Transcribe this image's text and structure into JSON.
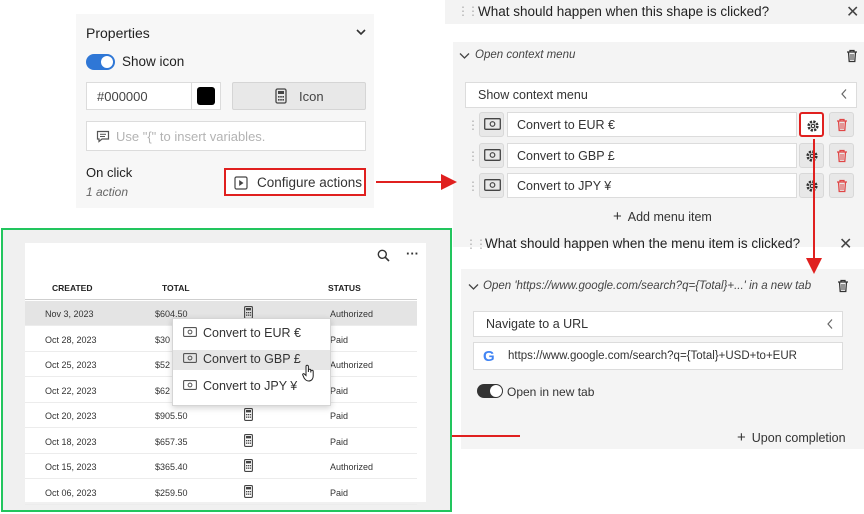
{
  "properties": {
    "title": "Properties",
    "show_icon_label": "Show icon",
    "color_value": "#000000",
    "icon_button_label": "Icon",
    "variables_placeholder": "Use \"{\" to insert variables.",
    "on_click_label": "On click",
    "action_count": "1 action",
    "configure_button_label": "Configure actions"
  },
  "menu_actions": {
    "question": "What should happen when this shape is clicked?",
    "action_title": "Open context menu",
    "action_type": "Show context menu",
    "items": [
      {
        "label": "Convert to EUR €"
      },
      {
        "label": "Convert to GBP £"
      },
      {
        "label": "Convert to JPY ¥"
      }
    ],
    "add_item_label": "Add menu item"
  },
  "item_actions": {
    "question": "What should happen when the menu item is clicked?",
    "action_title": "Open 'https://www.google.com/search?q={Total}+...' in a new tab",
    "action_type": "Navigate to a URL",
    "url": "https://www.google.com/search?q={Total}+USD+to+EUR",
    "new_tab_label": "Open in new tab",
    "upon_completion_label": "Upon completion"
  },
  "table": {
    "columns": [
      "CREATED",
      "TOTAL",
      "STATUS"
    ],
    "rows": [
      {
        "created": "Nov 3, 2023",
        "total": "$604.50",
        "status": "Authorized"
      },
      {
        "created": "Oct 28, 2023",
        "total": "$30",
        "status": "Paid"
      },
      {
        "created": "Oct 25, 2023",
        "total": "$52",
        "status": "Authorized"
      },
      {
        "created": "Oct 22, 2023",
        "total": "$62",
        "status": "Paid"
      },
      {
        "created": "Oct 20, 2023",
        "total": "$905.50",
        "status": "Paid"
      },
      {
        "created": "Oct 18, 2023",
        "total": "$657.35",
        "status": "Paid"
      },
      {
        "created": "Oct 15, 2023",
        "total": "$365.40",
        "status": "Authorized"
      },
      {
        "created": "Oct 06, 2023",
        "total": "$259.50",
        "status": "Paid"
      }
    ],
    "context_menu": [
      "Convert to EUR €",
      "Convert to GBP £",
      "Convert to JPY ¥"
    ]
  },
  "colors": {
    "highlight_red": "#e0201f",
    "preview_green": "#22c55e",
    "toggle_blue": "#2f77d6"
  }
}
